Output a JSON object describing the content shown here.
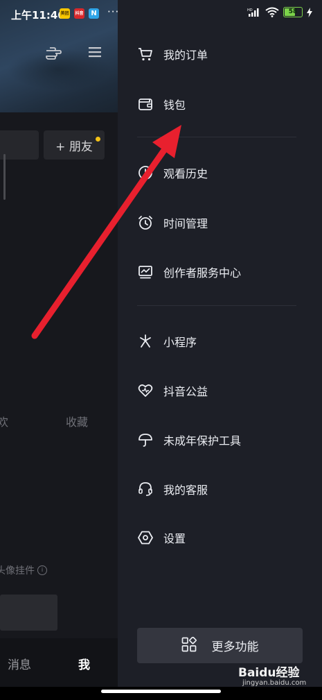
{
  "status_bar": {
    "time": "上午11:46",
    "apps": [
      "美团",
      "抖音",
      "N"
    ],
    "more": "···",
    "network": "HD",
    "battery": "58",
    "battery_level": 0.58
  },
  "profile_page": {
    "add_friend_label": "+ 朋友",
    "tabs": [
      "欢",
      "收藏"
    ],
    "pendant_label": "头像挂件",
    "nav": {
      "messages": "消息",
      "me": "我"
    }
  },
  "drawer": {
    "items": [
      {
        "label": "我的订单",
        "icon": "cart-icon"
      },
      {
        "label": "钱包",
        "icon": "wallet-icon"
      },
      {
        "label": "观看历史",
        "icon": "history-icon"
      },
      {
        "label": "时间管理",
        "icon": "alarm-icon"
      },
      {
        "label": "创作者服务中心",
        "icon": "creator-chart-icon"
      },
      {
        "label": "小程序",
        "icon": "mini-program-icon"
      },
      {
        "label": "抖音公益",
        "icon": "charity-heart-icon"
      },
      {
        "label": "未成年保护工具",
        "icon": "umbrella-icon"
      },
      {
        "label": "我的客服",
        "icon": "headset-icon"
      },
      {
        "label": "设置",
        "icon": "settings-hex-icon"
      }
    ],
    "more_button": "更多功能"
  },
  "watermark": {
    "brand": "Baidu经验",
    "url": "jingyan.baidu.com"
  },
  "colors": {
    "drawer_bg": "#1d1f27",
    "annotation_arrow": "#e8202e",
    "friend_dot": "#f5c317"
  }
}
